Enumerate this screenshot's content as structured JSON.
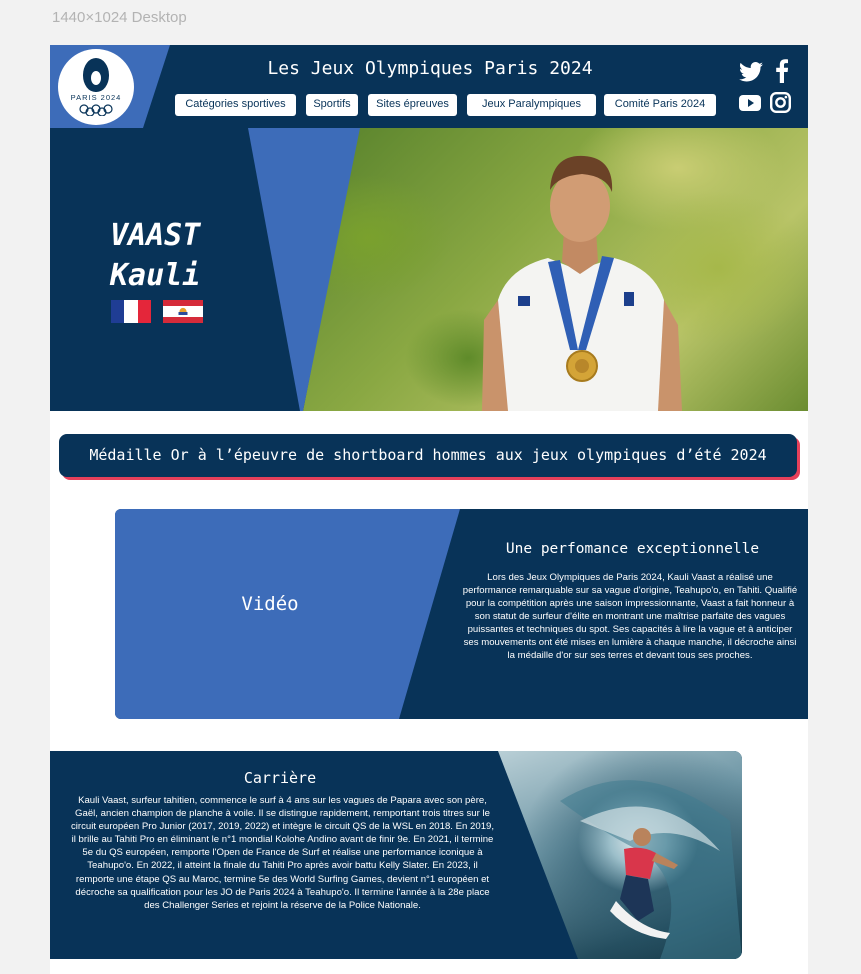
{
  "frame": {
    "label": "1440×1024 Desktop"
  },
  "header": {
    "logo_text": "PARIS 2024",
    "title": "Les Jeux Olympiques Paris 2024",
    "nav": [
      "Catégories sportives",
      "Sportifs",
      "Sites épreuves",
      "Jeux Paralympiques",
      "Comité Paris 2024"
    ],
    "social_icons": [
      "twitter-icon",
      "facebook-icon",
      "youtube-icon",
      "instagram-icon"
    ]
  },
  "hero": {
    "last_name": "VAAST",
    "first_name": "Kauli",
    "flags": [
      "france-flag",
      "french-polynesia-flag"
    ]
  },
  "banner": {
    "text": "Médaille Or à l’épeuvre de shortboard hommes aux jeux olympiques d’été 2024"
  },
  "performance": {
    "video_label": "Vidéo",
    "title": "Une perfomance exceptionnelle",
    "text": "Lors des Jeux Olympiques de Paris 2024, Kauli Vaast a réalisé une performance remarquable sur sa vague d'origine, Teahupo'o, en Tahiti. Qualifié pour la compétition après une saison impressionnante, Vaast a fait honneur à son statut de surfeur d'élite en montrant une maîtrise parfaite des vagues puissantes et techniques du spot. Ses capacités à lire la vague et à anticiper ses mouvements ont été mises en lumière à chaque manche, il décroche ainsi la médaille d'or sur ses terres et devant tous ses proches."
  },
  "career": {
    "title": "Carrière",
    "text": "Kauli Vaast, surfeur tahitien, commence le surf à 4 ans sur les vagues de Papara avec son père, Gaël, ancien champion de planche à voile. Il se distingue rapidement, remportant trois titres sur le circuit européen Pro Junior (2017, 2019, 2022) et intègre le circuit QS de la WSL en 2018. En 2019, il brille au Tahiti Pro en éliminant le n°1 mondial Kolohe Andino avant de finir 9e. En 2021, il termine 5e du QS européen, remporte l'Open de France de Surf et réalise une performance iconique à Teahupo'o. En 2022, il atteint la finale du Tahiti Pro après avoir battu Kelly Slater. En 2023, il remporte une étape QS au Maroc, termine 5e des World Surfing Games, devient n°1 européen et décroche sa qualification pour les JO de Paris 2024 à Teahupo'o. Il termine l'année à la 28e place des Challenger Series et rejoint la réserve de la Police Nationale."
  },
  "colors": {
    "navy": "#083358",
    "blue": "#3d6cb9",
    "accent_red": "#e6405a"
  }
}
